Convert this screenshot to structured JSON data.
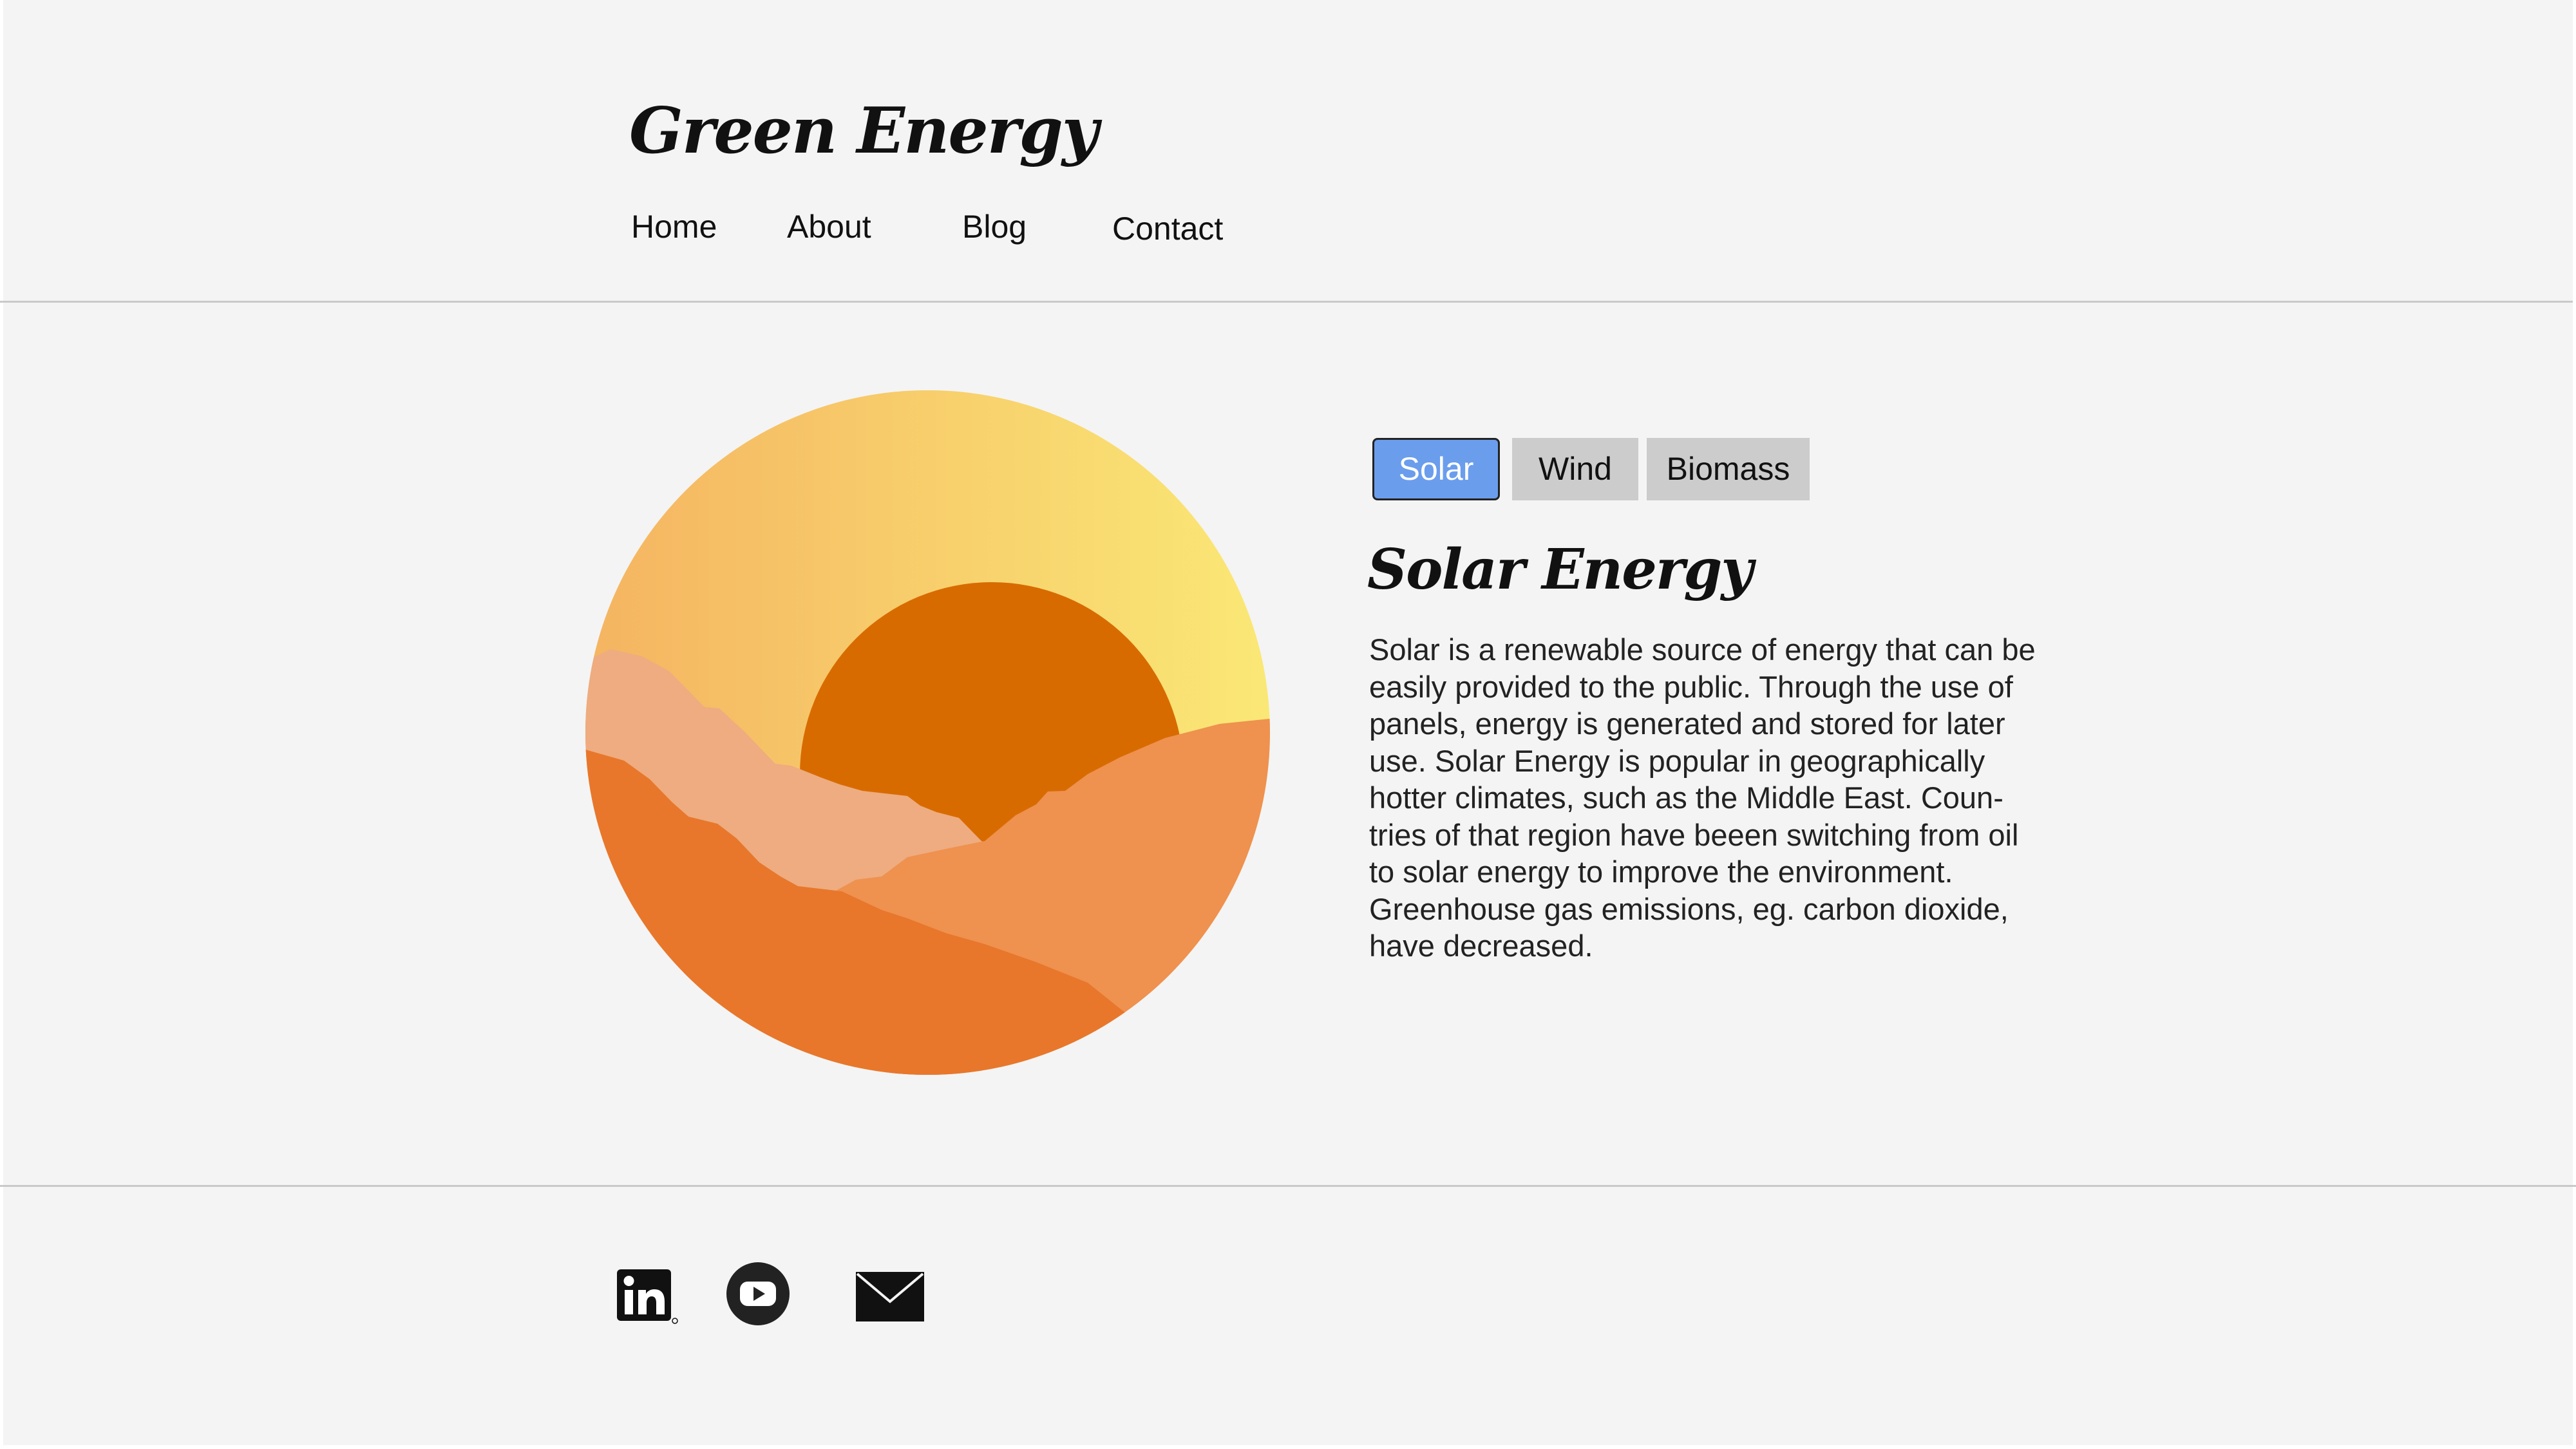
{
  "header": {
    "site_title": "Green Energy",
    "nav": [
      {
        "label": "Home"
      },
      {
        "label": "About"
      },
      {
        "label": "Blog"
      },
      {
        "label": "Contact"
      }
    ]
  },
  "main": {
    "illustration": {
      "name": "sunset-over-hills",
      "colors": {
        "sky_gradient_start": "#f5b461",
        "sky_gradient_end": "#fae876",
        "sun": "#d86b00",
        "hill_back": "#eeac80",
        "hill_right": "#ef914f",
        "hill_front": "#e8772b"
      }
    },
    "tabs": [
      {
        "label": "Solar",
        "selected": true
      },
      {
        "label": "Wind",
        "selected": false
      },
      {
        "label": "Biomass",
        "selected": false
      }
    ],
    "active_tab_color": "#6b9ded",
    "inactive_tab_color": "#cccccc",
    "section": {
      "heading": "Solar Energy",
      "body_lines": [
        "Solar is a renewable source of energy that can be",
        "easily provided to the public. Through the use of",
        "panels, energy is generated and stored for later",
        "use. Solar Energy is popular in geographically",
        "hotter climates, such as the Middle East. Coun-",
        "tries of that region have beeen switching from oil",
        "to solar energy to improve the environment.",
        "Greenhouse gas emissions, eg. carbon dioxide,",
        "have decreased."
      ]
    }
  },
  "footer": {
    "icons": [
      "linkedin-icon",
      "youtube-icon",
      "mail-icon"
    ]
  }
}
